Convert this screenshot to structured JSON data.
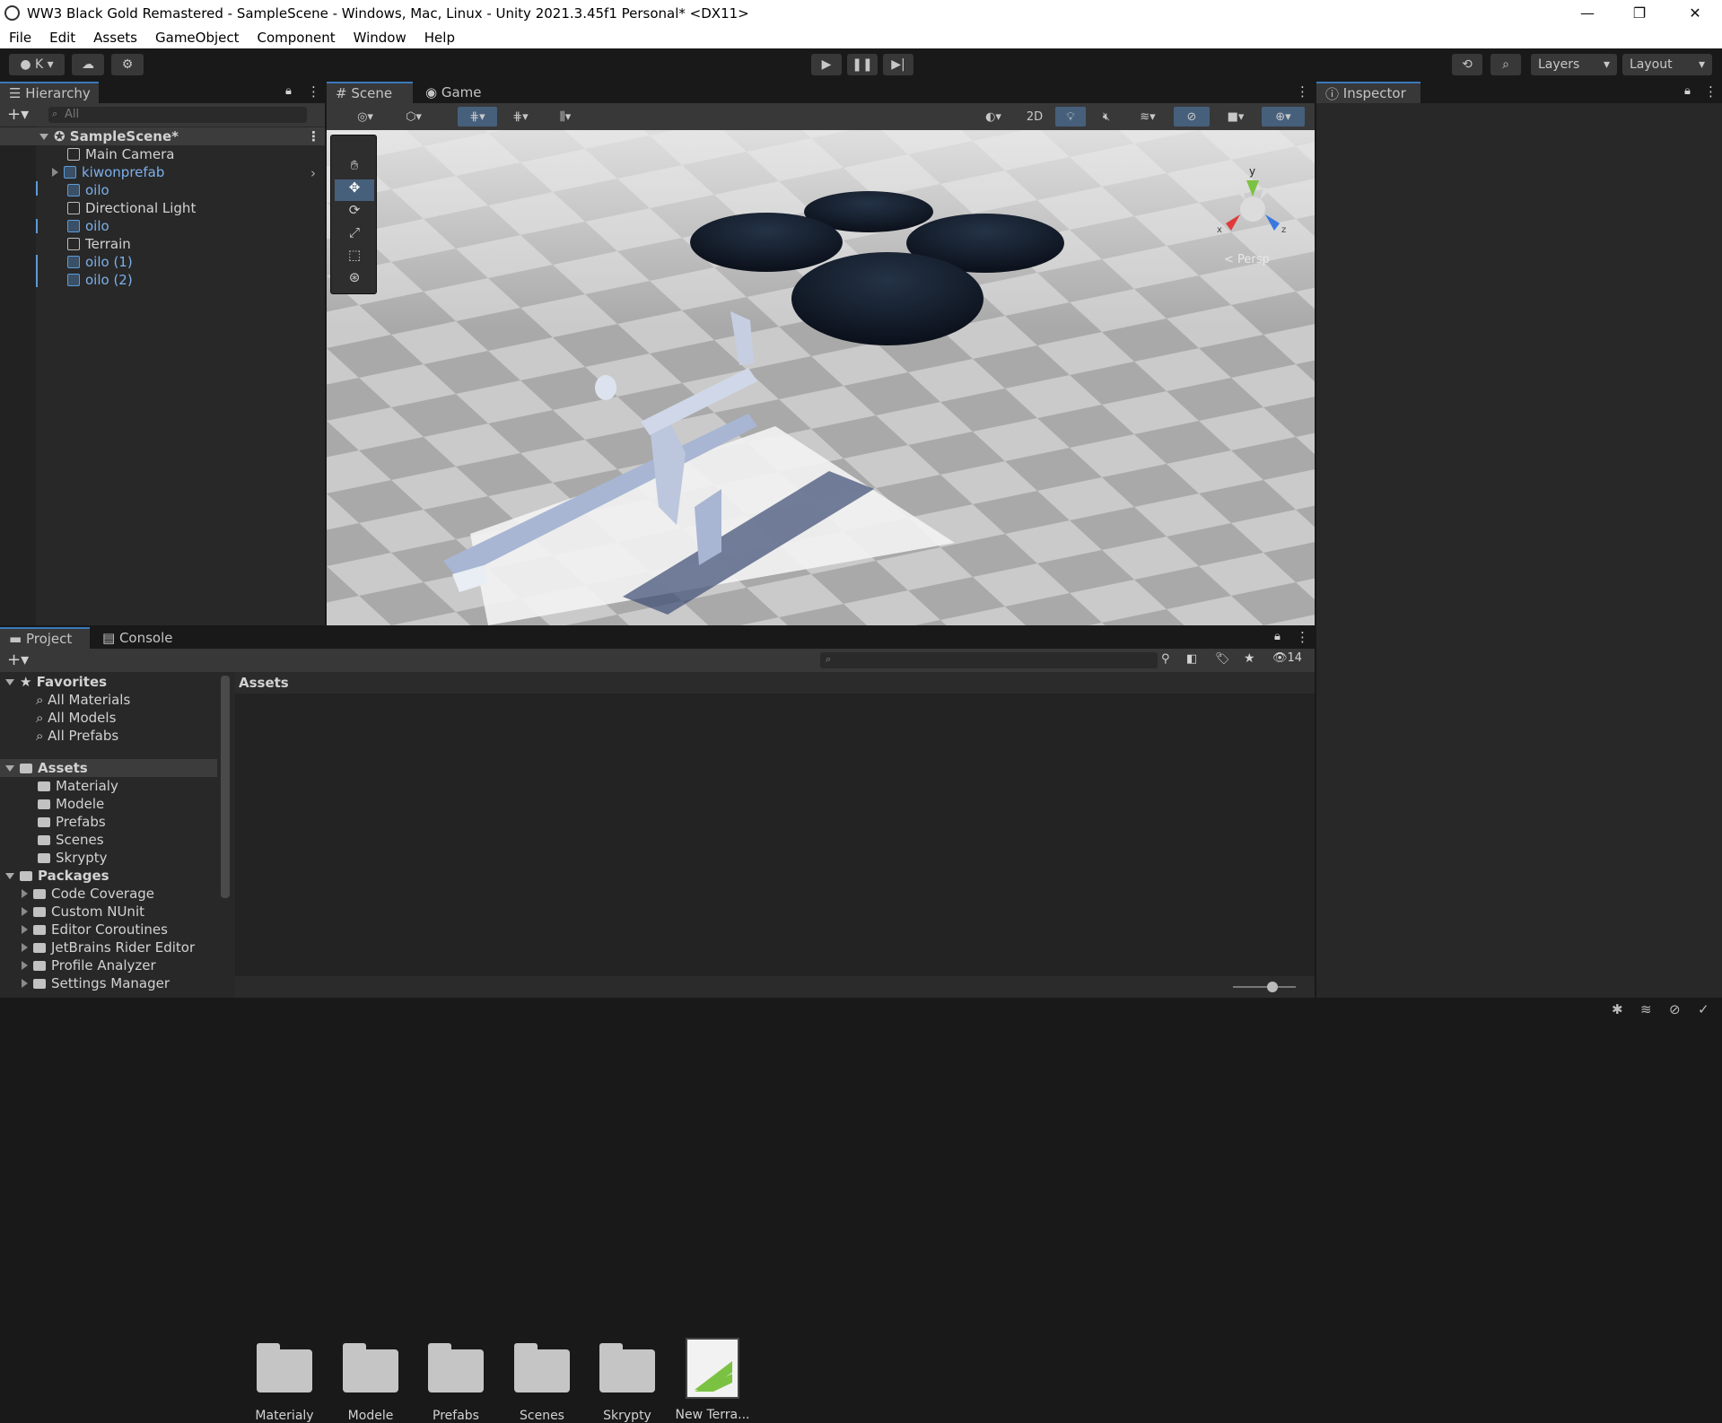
{
  "window": {
    "title": "WW3 Black Gold Remastered - SampleScene - Windows, Mac, Linux - Unity 2021.3.45f1 Personal* <DX11>"
  },
  "menu": [
    "File",
    "Edit",
    "Assets",
    "GameObject",
    "Component",
    "Window",
    "Help"
  ],
  "toolbar": {
    "account": "K",
    "layers": "Layers",
    "layout": "Layout"
  },
  "hierarchy": {
    "tab": "Hierarchy",
    "search_placeholder": "All",
    "scene": "SampleScene*",
    "items": [
      {
        "name": "Main Camera",
        "prefab": false
      },
      {
        "name": "kiwonprefab",
        "prefab": true
      },
      {
        "name": "oilo",
        "prefab": true
      },
      {
        "name": "Directional Light",
        "prefab": false
      },
      {
        "name": "oilo",
        "prefab": true
      },
      {
        "name": "Terrain",
        "prefab": false
      },
      {
        "name": "oilo (1)",
        "prefab": true
      },
      {
        "name": "oilo (2)",
        "prefab": true
      }
    ]
  },
  "scene_view": {
    "tab_scene": "Scene",
    "tab_game": "Game",
    "btn_2d": "2D",
    "gizmo_y": "y",
    "gizmo_x": "x",
    "gizmo_z": "z",
    "persp": "< Persp"
  },
  "inspector": {
    "tab": "Inspector"
  },
  "project": {
    "tab_project": "Project",
    "tab_console": "Console",
    "hidden_count": "14",
    "favorites": {
      "label": "Favorites",
      "items": [
        "All Materials",
        "All Models",
        "All Prefabs"
      ]
    },
    "assets": {
      "label": "Assets",
      "items": [
        "Materialy",
        "Modele",
        "Prefabs",
        "Scenes",
        "Skrypty"
      ]
    },
    "packages": {
      "label": "Packages",
      "items": [
        "Code Coverage",
        "Custom NUnit",
        "Editor Coroutines",
        "JetBrains Rider Editor",
        "Profile Analyzer",
        "Settings Manager"
      ]
    },
    "breadcrumb": "Assets",
    "grid": [
      "Materialy",
      "Modele",
      "Prefabs",
      "Scenes",
      "Skrypty",
      "New Terra..."
    ]
  },
  "colors": {
    "accent": "#3a79bb",
    "prefab": "#7cb0ea",
    "panel": "#282828",
    "dark": "#191919"
  }
}
